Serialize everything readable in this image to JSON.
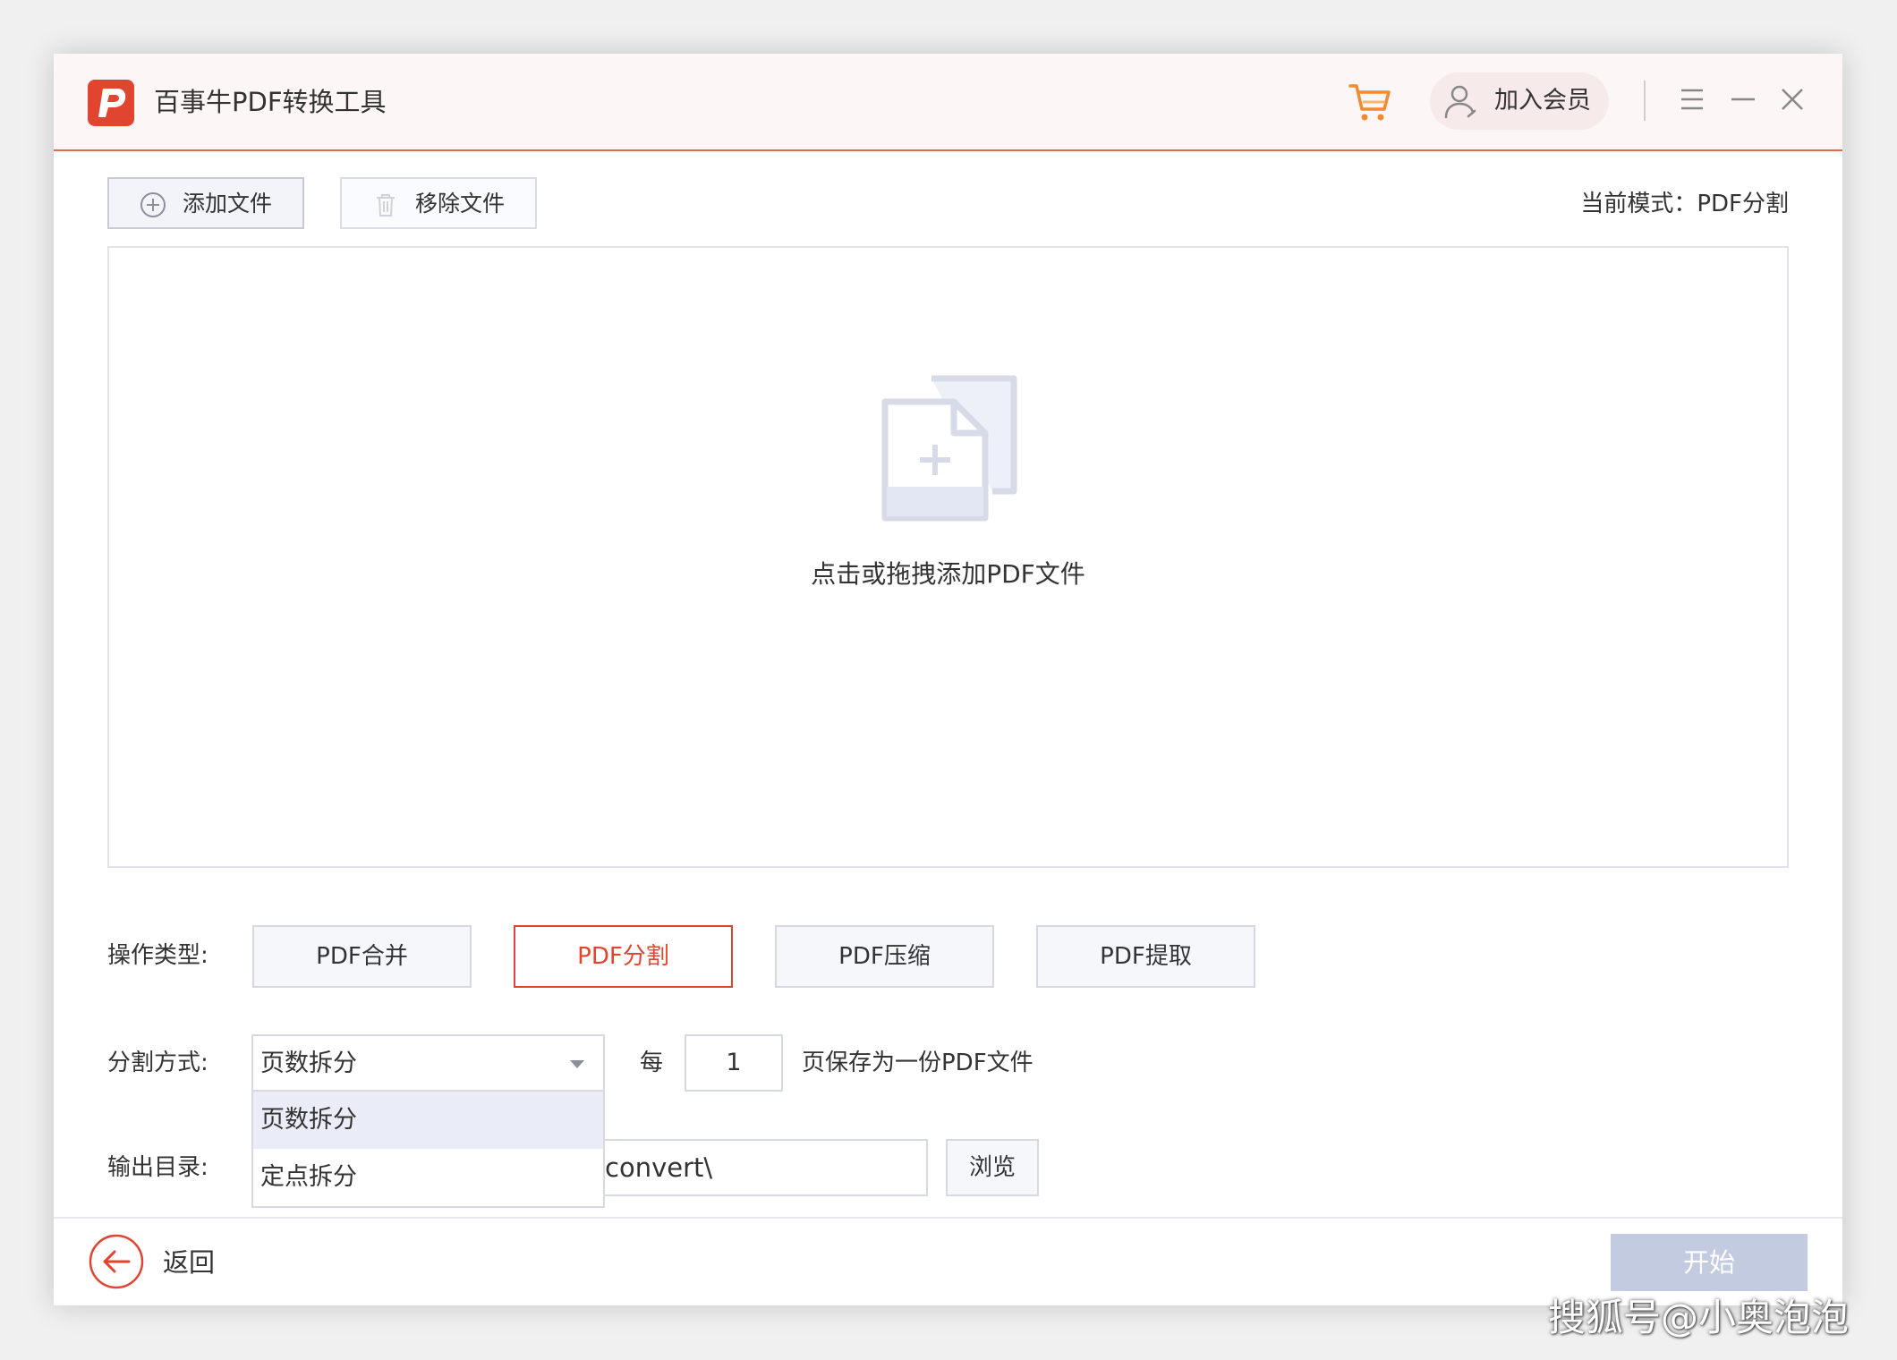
{
  "app": {
    "title": "百事牛PDF转换工具",
    "member_label": "加入会员",
    "accent_color": "#e2452f"
  },
  "toolbar": {
    "add_label": "添加文件",
    "remove_label": "移除文件",
    "mode_text": "当前模式：PDF分割"
  },
  "drop_zone": {
    "hint": "点击或拖拽添加PDF文件"
  },
  "operation": {
    "label": "操作类型:",
    "options": [
      {
        "label": "PDF合并"
      },
      {
        "label": "PDF分割"
      },
      {
        "label": "PDF压缩"
      },
      {
        "label": "PDF提取"
      }
    ],
    "selected": "PDF分割"
  },
  "split": {
    "label": "分割方式:",
    "selected": "页数拆分",
    "options": [
      "页数拆分",
      "定点拆分"
    ],
    "every_label": "每",
    "count": "1",
    "save_hint": "页保存为一份PDF文件"
  },
  "output": {
    "label": "输出目录:",
    "path": "DFconvert\\",
    "browse_label": "浏览"
  },
  "footer": {
    "back_label": "返回",
    "start_label": "开始"
  },
  "watermark": "搜狐号@小奥泡泡",
  "icons": [
    "logo-icon",
    "cart-icon",
    "user-icon",
    "menu-icon",
    "minimize-icon",
    "close-icon",
    "plus-circle-icon",
    "trash-icon",
    "add-file-icon",
    "chevron-down-icon",
    "back-arrow-icon"
  ]
}
